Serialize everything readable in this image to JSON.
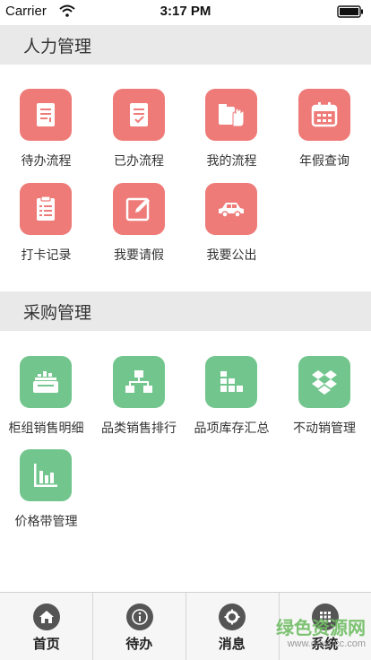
{
  "status_bar": {
    "carrier": "Carrier",
    "time": "3:17 PM"
  },
  "sections": [
    {
      "title": "人力管理",
      "items": [
        {
          "label": "待办流程",
          "icon": "pending-doc-icon",
          "color": "#ee7b78"
        },
        {
          "label": "已办流程",
          "icon": "done-doc-icon",
          "color": "#ee7b78"
        },
        {
          "label": "我的流程",
          "icon": "hand-folder-icon",
          "color": "#ee7b78"
        },
        {
          "label": "年假查询",
          "icon": "calendar-icon",
          "color": "#ee7b78"
        },
        {
          "label": "打卡记录",
          "icon": "clipboard-icon",
          "color": "#ee7b78"
        },
        {
          "label": "我要请假",
          "icon": "edit-icon",
          "color": "#ee7b78"
        },
        {
          "label": "我要公出",
          "icon": "car-icon",
          "color": "#ee7b78"
        }
      ]
    },
    {
      "title": "采购管理",
      "items": [
        {
          "label": "柜组销售明细",
          "icon": "cabinet-icon",
          "color": "#72c68d"
        },
        {
          "label": "品类销售排行",
          "icon": "hierarchy-icon",
          "color": "#72c68d"
        },
        {
          "label": "品项库存汇总",
          "icon": "stock-blocks-icon",
          "color": "#72c68d"
        },
        {
          "label": "不动销管理",
          "icon": "dropbox-icon",
          "color": "#72c68d"
        },
        {
          "label": "价格带管理",
          "icon": "bar-chart-icon",
          "color": "#72c68d"
        }
      ]
    }
  ],
  "tabbar": {
    "tabs": [
      {
        "label": "首页",
        "icon": "home-icon"
      },
      {
        "label": "待办",
        "icon": "info-icon"
      },
      {
        "label": "消息",
        "icon": "gear-icon"
      },
      {
        "label": "系统",
        "icon": "grid-icon"
      }
    ]
  },
  "watermark": {
    "main": "绿色资源网",
    "sub": "www.downcc.com"
  }
}
